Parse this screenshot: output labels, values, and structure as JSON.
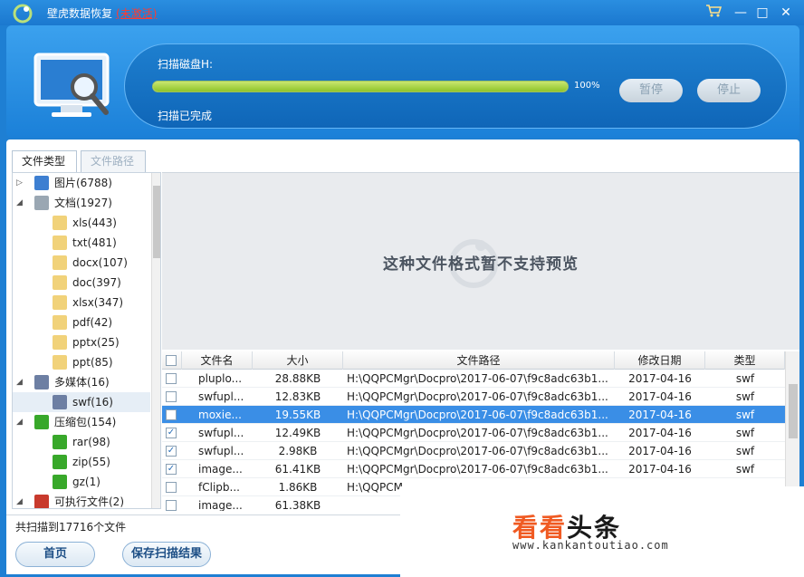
{
  "app": {
    "title": "壁虎数据恢复",
    "status": "(未激活)"
  },
  "scan": {
    "label": "扫描磁盘H:",
    "progress": 100,
    "progress_text": "100%",
    "status": "扫描已完成",
    "pause_label": "暂停",
    "stop_label": "停止"
  },
  "tabs": [
    "文件类型",
    "文件路径"
  ],
  "tree": [
    {
      "label": "图片(6788)",
      "level": 0,
      "expanded": false
    },
    {
      "label": "文档(1927)",
      "level": 0,
      "expanded": true
    },
    {
      "label": "xls(443)",
      "level": 1
    },
    {
      "label": "txt(481)",
      "level": 1
    },
    {
      "label": "docx(107)",
      "level": 1
    },
    {
      "label": "doc(397)",
      "level": 1
    },
    {
      "label": "xlsx(347)",
      "level": 1
    },
    {
      "label": "pdf(42)",
      "level": 1
    },
    {
      "label": "pptx(25)",
      "level": 1
    },
    {
      "label": "ppt(85)",
      "level": 1
    },
    {
      "label": "多媒体(16)",
      "level": 0,
      "expanded": true
    },
    {
      "label": "swf(16)",
      "level": 1,
      "selected": true
    },
    {
      "label": "压缩包(154)",
      "level": 0,
      "expanded": true
    },
    {
      "label": "rar(98)",
      "level": 1
    },
    {
      "label": "zip(55)",
      "level": 1
    },
    {
      "label": "gz(1)",
      "level": 1
    },
    {
      "label": "可执行文件(2)",
      "level": 0,
      "expanded": true
    }
  ],
  "preview": {
    "message": "这种文件格式暂不支持预览"
  },
  "table": {
    "columns": [
      "文件名",
      "大小",
      "文件路径",
      "修改日期",
      "类型"
    ],
    "rows": [
      {
        "checked": false,
        "name": "pluplo...",
        "size": "28.88KB",
        "path": "H:\\QQPCMgr\\Docpro\\2017-06-07\\f9c8adc63b1...",
        "date": "2017-04-16",
        "type": "swf"
      },
      {
        "checked": false,
        "name": "swfupl...",
        "size": "12.83KB",
        "path": "H:\\QQPCMgr\\Docpro\\2017-06-07\\f9c8adc63b1...",
        "date": "2017-04-16",
        "type": "swf"
      },
      {
        "checked": false,
        "name": "moxie...",
        "size": "19.55KB",
        "path": "H:\\QQPCMgr\\Docpro\\2017-06-07\\f9c8adc63b1...",
        "date": "2017-04-16",
        "type": "swf",
        "selected": true
      },
      {
        "checked": true,
        "name": "swfupl...",
        "size": "12.49KB",
        "path": "H:\\QQPCMgr\\Docpro\\2017-06-07\\f9c8adc63b1...",
        "date": "2017-04-16",
        "type": "swf"
      },
      {
        "checked": true,
        "name": "swfupl...",
        "size": "2.98KB",
        "path": "H:\\QQPCMgr\\Docpro\\2017-06-07\\f9c8adc63b1...",
        "date": "2017-04-16",
        "type": "swf"
      },
      {
        "checked": true,
        "name": "image...",
        "size": "61.41KB",
        "path": "H:\\QQPCMgr\\Docpro\\2017-06-07\\f9c8adc63b1...",
        "date": "2017-04-16",
        "type": "swf"
      },
      {
        "checked": false,
        "name": "fClipb...",
        "size": "1.86KB",
        "path": "H:\\QQPCM",
        "date": "",
        "type": ""
      },
      {
        "checked": false,
        "name": "image...",
        "size": "61.38KB",
        "path": "",
        "date": "",
        "type": ""
      }
    ]
  },
  "statusbar": {
    "text": "共扫描到17716个文件"
  },
  "buttons": {
    "home": "首页",
    "save": "保存扫描结果"
  },
  "watermark": {
    "title_a": "看看",
    "title_b": "头条",
    "url": "www.kankantoutiao.com"
  },
  "colors": {
    "accent": "#1e7fd3",
    "progress": "#8fc42a",
    "selected_row": "#3a8ee6",
    "inactive_text": "#ff3b30"
  }
}
